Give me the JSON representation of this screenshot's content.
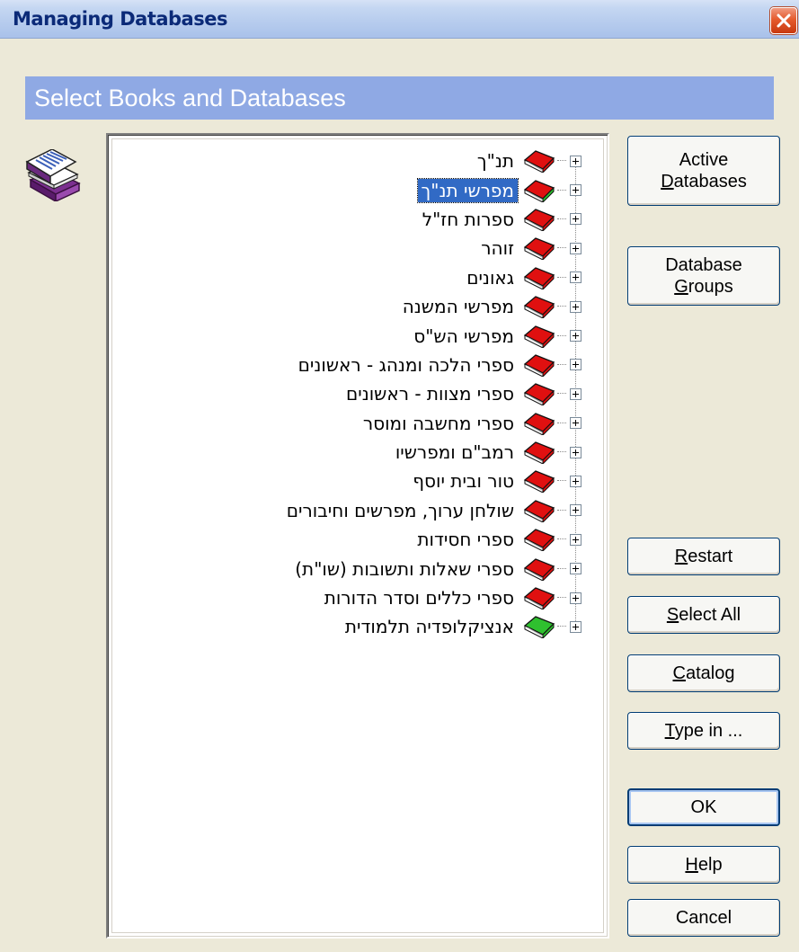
{
  "window": {
    "title": "Managing Databases",
    "close_icon": "close-icon"
  },
  "header": {
    "text": "Select Books and Databases"
  },
  "tree": {
    "items": [
      {
        "label": "תנ\"ך",
        "icon": "book-red"
      },
      {
        "label": "מפרשי תנ\"ך",
        "icon": "book-red-green",
        "selected": true
      },
      {
        "label": "ספרות חז\"ל",
        "icon": "book-red"
      },
      {
        "label": "זוהר",
        "icon": "book-red"
      },
      {
        "label": "גאונים",
        "icon": "book-red"
      },
      {
        "label": "מפרשי המשנה",
        "icon": "book-red"
      },
      {
        "label": "מפרשי הש\"ס",
        "icon": "book-red"
      },
      {
        "label": "ספרי הלכה ומנהג - ראשונים",
        "icon": "book-red"
      },
      {
        "label": "ספרי מצוות - ראשונים",
        "icon": "book-red"
      },
      {
        "label": "ספרי מחשבה ומוסר",
        "icon": "book-red"
      },
      {
        "label": "רמב\"ם ומפרשיו",
        "icon": "book-red"
      },
      {
        "label": "טור ובית יוסף",
        "icon": "book-red"
      },
      {
        "label": "שולחן ערוך, מפרשים וחיבורים",
        "icon": "book-red"
      },
      {
        "label": "ספרי חסידות",
        "icon": "book-red"
      },
      {
        "label": "ספרי שאלות ותשובות (שו\"ת)",
        "icon": "book-red"
      },
      {
        "label": "ספרי כללים וסדר הדורות",
        "icon": "book-red"
      },
      {
        "label": "אנציקלופדיה תלמודית",
        "icon": "book-green"
      }
    ]
  },
  "buttons": {
    "active_databases": {
      "line1": "Active",
      "line2_u": "D",
      "line2_rest": "atabases"
    },
    "database_groups": {
      "line1": "Database",
      "line2_u": "G",
      "line2_rest": "roups"
    },
    "restart": {
      "u": "R",
      "rest": "estart"
    },
    "select_all": {
      "u": "S",
      "rest": "elect All"
    },
    "catalog": {
      "u": "C",
      "rest": "atalog"
    },
    "type_in": {
      "u": "T",
      "rest": "ype in ..."
    },
    "ok": {
      "label": "OK"
    },
    "help": {
      "u": "H",
      "rest": "elp"
    },
    "cancel": {
      "label": "Cancel"
    }
  },
  "colors": {
    "header_band": "#8fa9e4",
    "selection": "#316ac5",
    "book_red": "#e01010",
    "book_green": "#2fc02f"
  }
}
